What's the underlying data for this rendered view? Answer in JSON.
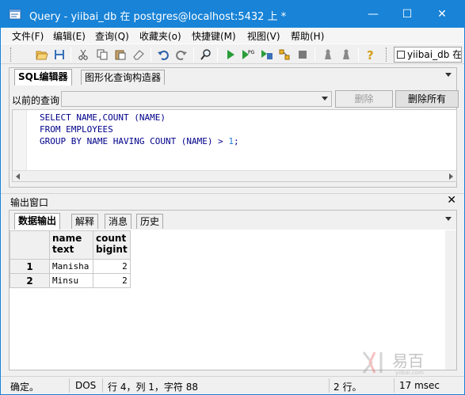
{
  "titlebar": {
    "title": "Query - yiibai_db 在  postgres@localhost:5432 上 *",
    "minimize": "—",
    "maximize": "☐",
    "close": "✕"
  },
  "menubar": {
    "items": [
      "文件(F)",
      "编辑(E)",
      "查询(Q)",
      "收藏夹(o)",
      "快捷键(M)",
      "视图(V)",
      "帮助(H)"
    ]
  },
  "toolbar": {
    "db_selector": "yiibai_db 在"
  },
  "editor": {
    "tabs": [
      "SQL编辑器",
      "图形化查询构造器"
    ],
    "previous_query_label": "以前的查询",
    "delete_button": "删除",
    "delete_all_button": "删除所有",
    "code_lines": [
      [
        {
          "t": "SELECT NAME,COUNT (NAME)",
          "c": "kw"
        }
      ],
      [
        {
          "t": "FROM EMPLOYEES",
          "c": "kw"
        }
      ],
      [
        {
          "t": "GROUP BY NAME HAVING COUNT (NAME) > ",
          "c": "kw"
        },
        {
          "t": "1",
          "c": "num"
        },
        {
          "t": ";",
          "c": "kw"
        }
      ]
    ]
  },
  "output": {
    "title": "输出窗口",
    "close": "✕",
    "tabs": [
      "数据输出",
      "解释",
      "消息",
      "历史"
    ],
    "columns": [
      {
        "name": "name",
        "type": "text"
      },
      {
        "name": "count",
        "type": "bigint"
      }
    ],
    "rows": [
      {
        "num": "1",
        "name": "Manisha",
        "count": "2"
      },
      {
        "num": "2",
        "name": "Minsu",
        "count": "2"
      }
    ]
  },
  "statusbar": {
    "status": "确定。",
    "encoding": "DOS",
    "position": "行 4，列 1，字符 88",
    "row_count": "2 行。",
    "time": "17 msec"
  },
  "watermark": {
    "text": "易百",
    "sub": "yiibai.com"
  }
}
